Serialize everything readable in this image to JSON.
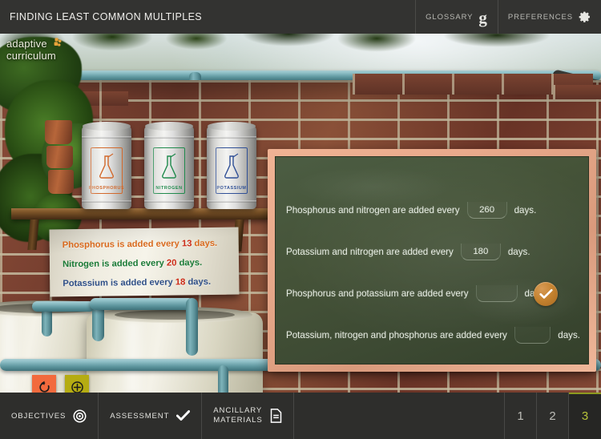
{
  "header": {
    "title": "FINDING LEAST COMMON MULTIPLES",
    "glossary_label": "GLOSSARY",
    "glossary_icon": "glossary-g-icon",
    "preferences_label": "PREFERENCES",
    "preferences_icon": "gear-icon"
  },
  "logo": {
    "line1": "adaptive",
    "line2": "curriculum",
    "mark_color": "#e8a33a"
  },
  "scene": {
    "canisters": [
      {
        "name": "PHOSPHORUS",
        "color": "#d2692c"
      },
      {
        "name": "NITROGEN",
        "color": "#1f8a4c"
      },
      {
        "name": "POTASSIUM",
        "color": "#2f4f96"
      }
    ],
    "sign": {
      "lines": [
        {
          "prefix": "Phosphorus is added every ",
          "number": "13",
          "suffix": " days.",
          "color": "#d96a1e"
        },
        {
          "prefix": "Nitrogen is added every ",
          "number": "20",
          "suffix": " days.",
          "color": "#1a7a36"
        },
        {
          "prefix": "Potassium is added every ",
          "number": "18",
          "suffix": " days.",
          "color": "#2f4f87"
        }
      ],
      "number_color": "#cc2a16"
    },
    "tools": [
      {
        "name": "reset",
        "icon": "reset-circular-arrow-icon",
        "color": "#f26a3d"
      },
      {
        "name": "zoom-in",
        "icon": "plus-circle-icon",
        "color": "#b5ac12"
      }
    ]
  },
  "board": {
    "questions": [
      {
        "prefix": "Phosphorus and nitrogen are added every",
        "value": "260",
        "suffix": "days."
      },
      {
        "prefix": "Potassium and nitrogen are added every",
        "value": "180",
        "suffix": "days."
      },
      {
        "prefix": "Phosphorus and potassium are added every",
        "value": "",
        "suffix": "days."
      },
      {
        "prefix": "Potassium, nitrogen and phosphorus are added every",
        "value": "",
        "suffix": "days."
      }
    ],
    "submit_icon": "check-icon",
    "submit_color": "#c4822f"
  },
  "footer": {
    "objectives_label": "OBJECTIVES",
    "objectives_icon": "target-icon",
    "assessment_label": "ASSESSMENT",
    "assessment_icon": "check-icon",
    "ancillary_label_line1": "ANCILLARY",
    "ancillary_label_line2": "MATERIALS",
    "ancillary_icon": "document-icon",
    "pages": [
      "1",
      "2",
      "3"
    ],
    "active_page": "3",
    "active_color": "#b7c23a"
  }
}
